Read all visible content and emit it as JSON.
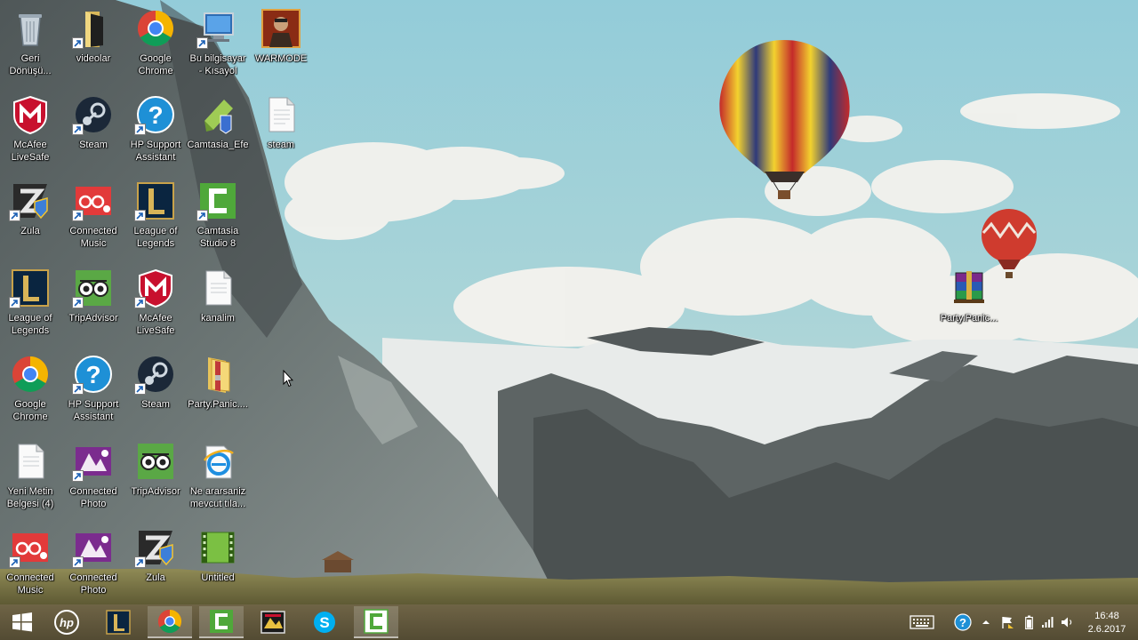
{
  "desktop": {
    "icons": [
      {
        "label": "Geri\nDönüşü...",
        "icon": "recycle-bin-icon"
      },
      {
        "label": "videolar",
        "icon": "folder-icon"
      },
      {
        "label": "Google\nChrome",
        "icon": "chrome-icon"
      },
      {
        "label": "Bu bilgisayar\n- Kısayol",
        "icon": "computer-icon"
      },
      {
        "label": "WARMODE",
        "icon": "warmode-icon"
      },
      {
        "label": "McAfee\nLiveSafe",
        "icon": "mcafee-icon"
      },
      {
        "label": "Steam",
        "icon": "steam-icon"
      },
      {
        "label": "HP Support\nAssistant",
        "icon": "hp-support-icon"
      },
      {
        "label": "Camtasia_Efe",
        "icon": "camtasia-project-icon"
      },
      {
        "label": "steam",
        "icon": "text-file-icon"
      },
      {
        "label": "Zula",
        "icon": "zula-icon"
      },
      {
        "label": "Connected\nMusic",
        "icon": "connected-music-icon"
      },
      {
        "label": "League of\nLegends",
        "icon": "league-icon"
      },
      {
        "label": "Camtasia\nStudio 8",
        "icon": "camtasia-icon"
      },
      {
        "label": "League of\nLegends",
        "icon": "league-icon"
      },
      {
        "label": "TripAdvisor",
        "icon": "tripadvisor-icon"
      },
      {
        "label": "McAfee\nLiveSafe",
        "icon": "mcafee-icon"
      },
      {
        "label": "kanalim",
        "icon": "text-file-icon"
      },
      {
        "label": "Google\nChrome",
        "icon": "chrome-icon"
      },
      {
        "label": "HP Support\nAssistant",
        "icon": "hp-support-icon"
      },
      {
        "label": "Steam",
        "icon": "steam-icon"
      },
      {
        "label": "Party.Panic....",
        "icon": "zip-folder-icon"
      },
      {
        "label": "Yeni Metin\nBelgesi (4)",
        "icon": "text-file-icon"
      },
      {
        "label": "Connected\nPhoto",
        "icon": "connected-photo-icon"
      },
      {
        "label": "TripAdvisor",
        "icon": "tripadvisor-icon"
      },
      {
        "label": "Ne ararsaniz\nmevcut tıla...",
        "icon": "internet-explorer-icon"
      },
      {
        "label": "Connected\nMusic",
        "icon": "connected-music-icon"
      },
      {
        "label": "Connected\nPhoto",
        "icon": "connected-photo-icon"
      },
      {
        "label": "Zula",
        "icon": "zula-icon"
      },
      {
        "label": "Untitled",
        "icon": "video-file-icon"
      },
      {
        "label": "Party.Panic...",
        "icon": "winrar-icon"
      }
    ]
  },
  "taskbar": {
    "buttons": [
      {
        "icon": "windows-start-icon"
      },
      {
        "icon": "hp-logo-icon"
      },
      {
        "icon": "league-icon"
      },
      {
        "icon": "chrome-icon"
      },
      {
        "icon": "camtasia-icon"
      },
      {
        "icon": "warmode-icon"
      },
      {
        "icon": "skype-icon"
      },
      {
        "icon": "camtasia-recorder-icon"
      }
    ],
    "tray": [
      "keyboard-icon",
      "help-icon",
      "chevron-up-icon",
      "flag-icon",
      "battery-icon",
      "network-icon",
      "volume-icon"
    ],
    "clock": {
      "time": "16:48",
      "date": "2.6.2017"
    }
  },
  "colors": {
    "sky": "#8ec7d6",
    "taskbar": "#5e563c",
    "accent_chrome_red": "#db4437",
    "accent_camtasia_green": "#4fa83a"
  }
}
